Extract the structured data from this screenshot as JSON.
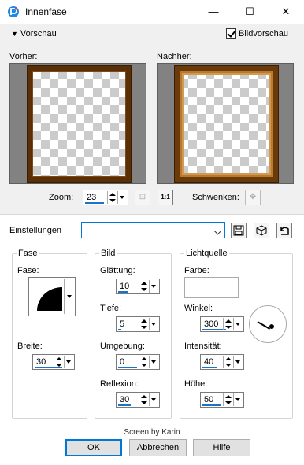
{
  "window": {
    "title": "Innenfase",
    "minimize": "—",
    "maximize": "☐",
    "close": "✕"
  },
  "preview": {
    "header": "Vorschau",
    "checkbox_label": "Bildvorschau",
    "checkbox_checked": true,
    "before_label": "Vorher:",
    "after_label": "Nachher:",
    "zoom_label": "Zoom:",
    "zoom_value": "23",
    "pan_label": "Schwenken:"
  },
  "settings": {
    "label": "Einstellungen",
    "preset_value": ""
  },
  "fase_group": {
    "title": "Fase",
    "fase_label": "Fase:",
    "breite_label": "Breite:",
    "breite_value": "30"
  },
  "bild_group": {
    "title": "Bild",
    "glaettung_label": "Glättung:",
    "glaettung_value": "10",
    "tiefe_label": "Tiefe:",
    "tiefe_value": "5",
    "umgebung_label": "Umgebung:",
    "umgebung_value": "0",
    "reflexion_label": "Reflexion:",
    "reflexion_value": "30"
  },
  "licht_group": {
    "title": "Lichtquelle",
    "farbe_label": "Farbe:",
    "winkel_label": "Winkel:",
    "winkel_value": "300",
    "intensitaet_label": "Intensität:",
    "intensitaet_value": "40",
    "hoehe_label": "Höhe:",
    "hoehe_value": "50"
  },
  "footer": {
    "credit": "Screen by Karin",
    "ok": "OK",
    "cancel": "Abbrechen",
    "help": "Hilfe"
  },
  "colors": {
    "accent": "#0078d7",
    "frame_brown": "#5a2f06",
    "preview_bg": "#828282"
  }
}
